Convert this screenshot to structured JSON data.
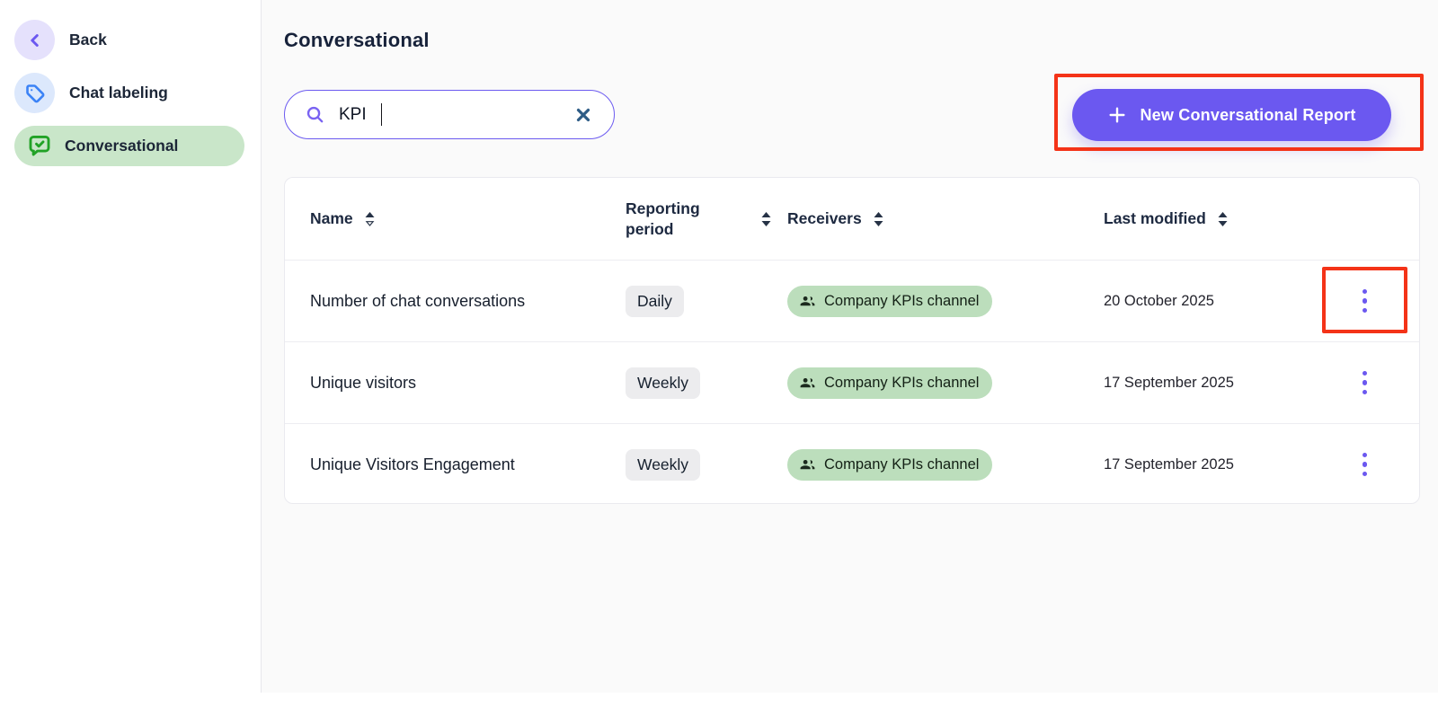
{
  "colors": {
    "accent_purple": "#6b58f0",
    "sidebar_selected_green": "#c9e6c9",
    "receiver_chip_green": "#bcdebc",
    "period_badge_gray": "#ececee",
    "annotation_red": "#f43318",
    "tag_icon_blue": "#3b82f6",
    "chat_icon_green": "#21a226",
    "main_background": "#fafafa"
  },
  "sidebar": {
    "items": [
      {
        "label": "Back",
        "icon": "chevron-left-icon",
        "selected": false
      },
      {
        "label": "Chat labeling",
        "icon": "tag-icon",
        "selected": false
      },
      {
        "label": "Conversational",
        "icon": "chat-check-icon",
        "selected": true
      }
    ]
  },
  "header": {
    "title": "Conversational"
  },
  "search": {
    "value": "KPI",
    "placeholder": ""
  },
  "toolbar": {
    "new_report_label": "New Conversational Report"
  },
  "table": {
    "columns": [
      {
        "label": "Name",
        "sortable": true,
        "sort_state": "ascending"
      },
      {
        "label": "Reporting period",
        "sortable": true,
        "sort_state": "none"
      },
      {
        "label": "Receivers",
        "sortable": true,
        "sort_state": "none"
      },
      {
        "label": "Last modified",
        "sortable": true,
        "sort_state": "none"
      }
    ],
    "rows": [
      {
        "name": "Number of chat conversations",
        "period": "Daily",
        "receivers": "Company KPIs channel",
        "date": "20 October 2025"
      },
      {
        "name": "Unique visitors",
        "period": "Weekly",
        "receivers": "Company KPIs channel",
        "date": "17 September 2025"
      },
      {
        "name": "Unique Visitors Engagement",
        "period": "Weekly",
        "receivers": "Company KPIs channel",
        "date": "17 September 2025"
      }
    ]
  },
  "annotations": {
    "highlighted_elements": [
      "new-report-button",
      "row-0-kebab-menu"
    ]
  }
}
